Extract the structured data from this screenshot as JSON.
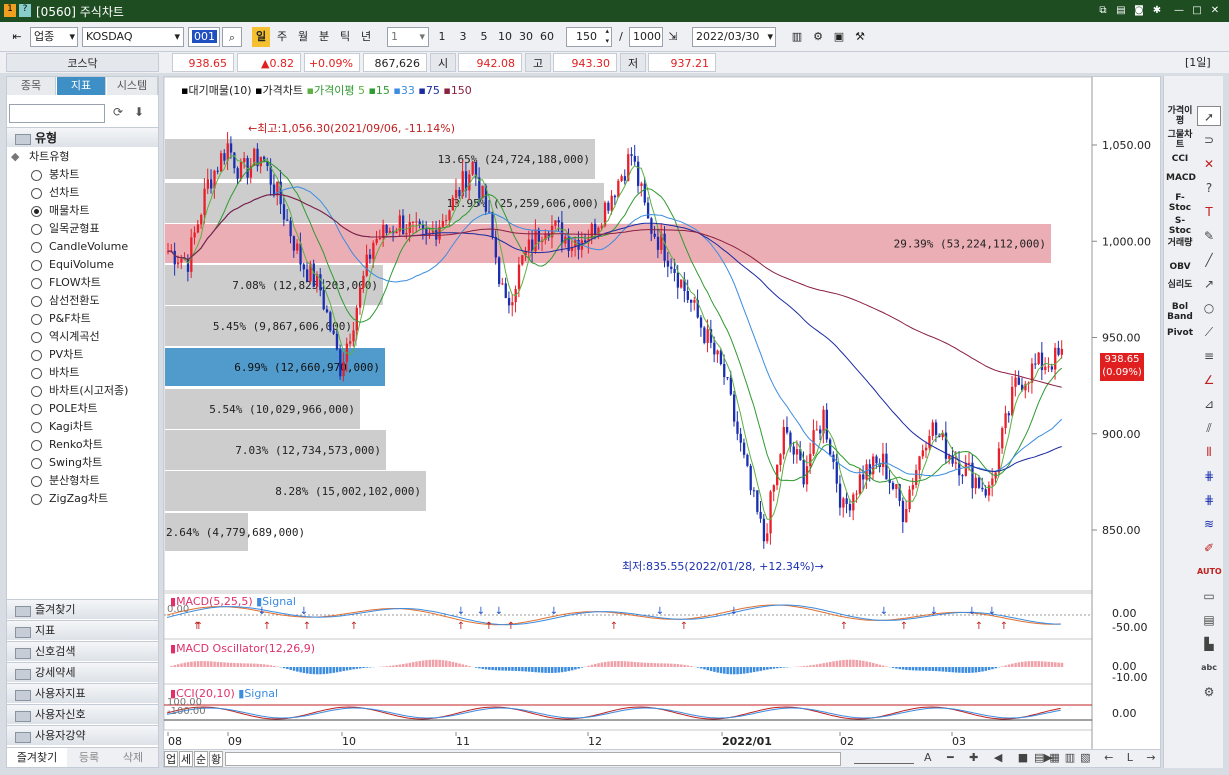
{
  "window": {
    "code": "[0560]",
    "title": "주식차트",
    "date_badge": "[1일]"
  },
  "toolbar": {
    "market_type": "업종",
    "market": "KOSDAQ",
    "code_field": "001",
    "periods": [
      "일",
      "주",
      "월",
      "분",
      "틱",
      "년"
    ],
    "interval_value": "1",
    "quick_nums": [
      "1",
      "3",
      "5",
      "10",
      "30",
      "60"
    ],
    "count": "150",
    "slash": "/",
    "total": "1000",
    "date": "2022/03/30"
  },
  "pricebar": {
    "name": "코스닥",
    "current": "938.65",
    "change": "▲0.82",
    "rate": "+0.09%",
    "volume": "867,626",
    "open_label": "시",
    "open": "942.08",
    "high_label": "고",
    "high": "943.30",
    "low_label": "저",
    "low": "937.21"
  },
  "left": {
    "tabs": [
      "종목",
      "지표",
      "시스템"
    ],
    "section_title": "유형",
    "tree_root": "차트유형",
    "chart_types": [
      "봉차트",
      "선차트",
      "매물차트",
      "일목균형표",
      "CandleVolume",
      "EquiVolume",
      "FLOW차트",
      "삼선전환도",
      "P&F차트",
      "역시계곡선",
      "PV차트",
      "바차트",
      "바차트(시고저종)",
      "POLE차트",
      "Kagi차트",
      "Renko차트",
      "Swing차트",
      "분산형차트",
      "ZigZag차트"
    ],
    "selected": "매물차트",
    "sections": [
      "즐겨찾기",
      "지표",
      "신호검색",
      "강세약세",
      "사용자지표",
      "사용자신호",
      "사용자강약"
    ],
    "bottom_tabs": [
      "즐겨찾기",
      "등록",
      "삭제"
    ]
  },
  "chart": {
    "legend": {
      "vol_profile": "대기매물(10)",
      "price": "가격차트",
      "ma_label": "가격이평",
      "ma5": "5",
      "ma15": "15",
      "ma33": "33",
      "ma75": "75",
      "ma150": "150"
    },
    "high_ann": "←최고:1,056.30(2021/09/06, -11.14%)",
    "low_ann": "최저:835.55(2022/01/28, +12.34%)→",
    "price_axis": [
      "1,050.00",
      "1,000.00",
      "950.00",
      "900.00",
      "850.00"
    ],
    "price_tag": "938.65",
    "price_tag_rate": "(0.09%)",
    "profile_labels": [
      "13.65% (24,724,188,000)",
      "13.95% (25,259,606,000)",
      "29.39% (53,224,112,000)",
      "7.08% (12,825,203,000)",
      "5.45% (9,867,606,000)",
      "6.99% (12,660,970,000)",
      "5.54% (10,029,966,000)",
      "7.03% (12,734,573,000)",
      "8.28% (15,002,102,000)",
      "2.64% (4,779,689,000)"
    ],
    "macd": {
      "title": "MACD(5,25,5)",
      "signal": "Signal",
      "zero": "0.00",
      "axis": [
        "0.00",
        "-50.00"
      ]
    },
    "osc": {
      "title": "MACD Oscillator(12,26,9)",
      "axis": [
        "0.00",
        "-10.00"
      ]
    },
    "cci": {
      "title": "CCI(20,10)",
      "signal": "Signal",
      "top": "100.00",
      "bot": "-100.00",
      "axis": [
        "0.00"
      ]
    },
    "x_labels": [
      "08",
      "09",
      "10",
      "11",
      "12",
      "2022/01",
      "02",
      "03"
    ],
    "bottom_btns": [
      "업",
      "세",
      "순",
      "황"
    ]
  },
  "right_indicators": [
    "가격이평",
    "그물차트",
    "CCI",
    "MACD",
    "F-Stoc",
    "S-Stoc",
    "거래량",
    "OBV",
    "심리도",
    "Bol Band",
    "Pivot"
  ],
  "colors": {
    "up": "#e8202a",
    "down": "#1a2fb0",
    "ma5": "#5db040",
    "ma15": "#2f9a2f",
    "ma33": "#3c8ce0",
    "ma75": "#1b2aa0",
    "ma150": "#8b2040",
    "profile": "#c8c8c8",
    "profile_hi": "#e8a0a8",
    "profile_sel": "#3d8fc6"
  }
}
